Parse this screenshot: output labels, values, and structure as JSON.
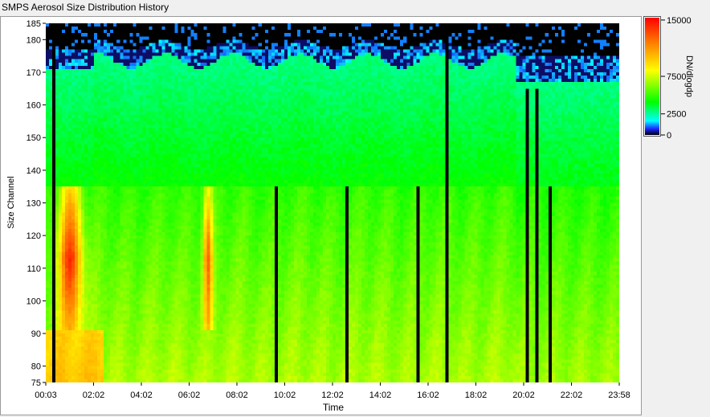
{
  "window": {
    "title": "SMPS Aerosol Size Distribution History"
  },
  "chart_data": {
    "type": "heatmap",
    "title": "SMPS Aerosol Size Distribution History",
    "xlabel": "Time",
    "ylabel": "Size Channel",
    "x_ticks": [
      "00:03",
      "02:02",
      "04:02",
      "06:02",
      "08:02",
      "10:02",
      "12:02",
      "14:02",
      "16:02",
      "18:02",
      "20:02",
      "22:02",
      "23:58"
    ],
    "y_ticks": [
      75,
      80,
      90,
      100,
      110,
      120,
      130,
      140,
      150,
      160,
      170,
      180,
      185
    ],
    "ylim": [
      75,
      185
    ],
    "colorbar": {
      "label": "DN/dlogdp",
      "ticks": [
        0,
        2500,
        7500,
        15000
      ],
      "tick_labels": [
        "0",
        "2500",
        "7500",
        "15000"
      ],
      "range": [
        0,
        15000
      ],
      "colors": [
        "#000000",
        "#2020ff",
        "#00ffff",
        "#00ff00",
        "#ffff00",
        "#ff8000",
        "#ff0000"
      ]
    },
    "gaps_in_data_at_time": [
      "00:10",
      "09:42",
      "12:27",
      "15:28",
      "16:45",
      "20:01",
      "20:23",
      "21:26"
    ]
  }
}
